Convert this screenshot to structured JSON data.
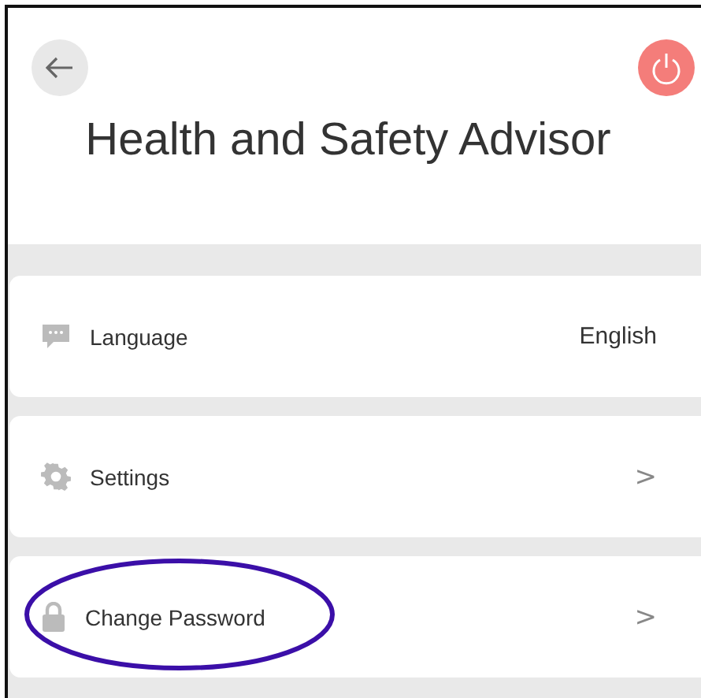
{
  "header": {
    "title": "Health and Safety Advisor"
  },
  "items": [
    {
      "kind": "value",
      "label": "Language",
      "value": "English"
    },
    {
      "kind": "link",
      "label": "Settings",
      "chevron": ">"
    },
    {
      "kind": "link",
      "label": "Change Password",
      "chevron": ">"
    }
  ]
}
